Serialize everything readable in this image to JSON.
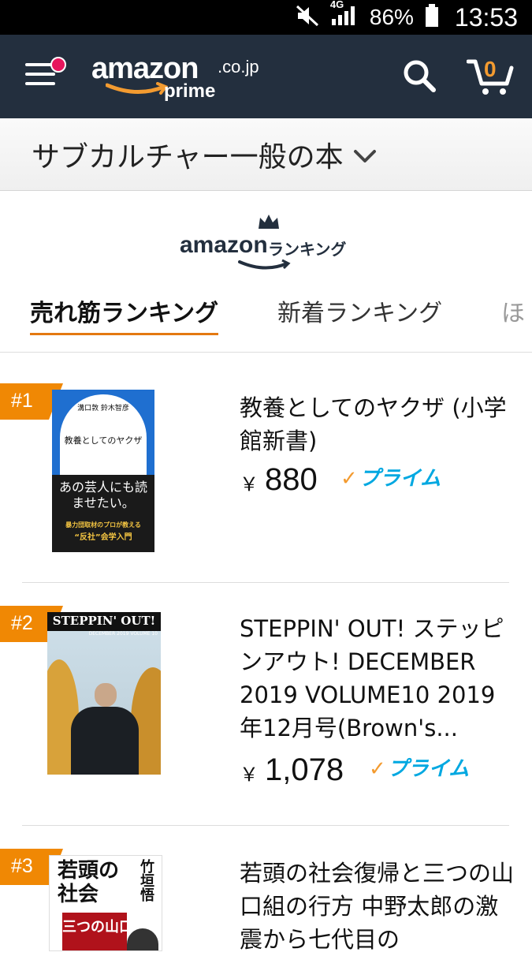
{
  "status_bar": {
    "network": "4G",
    "battery": "86%",
    "time": "13:53"
  },
  "header": {
    "logo_main": "amazon",
    "logo_domain": ".co.jp",
    "logo_sub": "prime",
    "cart_count": "0"
  },
  "category": {
    "label": "サブカルチャー一般の本"
  },
  "ranking_logo": {
    "brand": "amazon",
    "subtitle": "ランキング"
  },
  "tabs": [
    {
      "label": "売れ筋ランキング"
    },
    {
      "label": "新着ランキング"
    },
    {
      "label": "ほ"
    }
  ],
  "items": [
    {
      "rank": "#1",
      "title": "教養としてのヤクザ (小学館新書)",
      "yen": "￥",
      "price": "880",
      "prime": "プライム",
      "cover": {
        "authors": "溝口敦 鈴木智彦",
        "book_title": "教養としてのヤクザ",
        "headline": "あの芸人にも読ませたい。",
        "tagline": "暴力団取材のプロが教える",
        "tagline2": "“反社”会学入門"
      }
    },
    {
      "rank": "#2",
      "title": "STEPPIN' OUT! ステッピンアウト! DECEMBER 2019 VOLUME10 2019年12月号(Brown's...",
      "yen": "￥",
      "price": "1,078",
      "prime": "プライム",
      "cover": {
        "masthead": "STEPPIN' OUT!",
        "issue": "DECEMBER 2019 VOLUME 10"
      }
    },
    {
      "rank": "#3",
      "title": "若頭の社会復帰と三つの山口組の行方 中野太郎の激震から七代目の",
      "cover": {
        "author": "竹垣悟",
        "book_title": "若頭の社会",
        "subtitle": "三つの山口"
      }
    }
  ],
  "colors": {
    "nav_bg": "#232f3e",
    "accent_orange": "#e47911",
    "badge_orange": "#f08804",
    "prime_blue": "#00a8e1",
    "notification_pink": "#e7165d"
  },
  "icons": [
    "mute-icon",
    "signal-icon",
    "battery-icon",
    "menu-icon",
    "search-icon",
    "cart-icon",
    "chevron-down-icon",
    "crown-icon",
    "prime-check-icon"
  ]
}
